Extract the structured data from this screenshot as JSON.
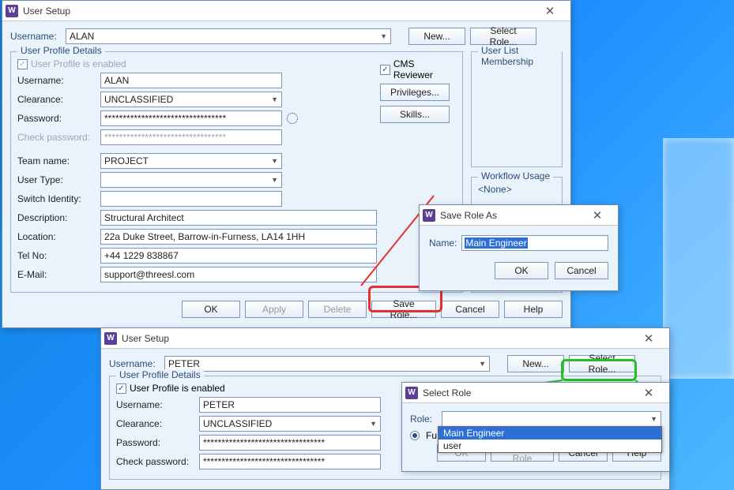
{
  "win1": {
    "title": "User Setup",
    "usernameLabel": "Username:",
    "usernameValue": "ALAN",
    "newBtn": "New...",
    "selectRoleBtn": "Select Role...",
    "profileGroup": "User Profile Details",
    "profileEnabled": "User Profile is enabled",
    "cmsReviewer": "CMS Reviewer",
    "privilegesBtn": "Privileges...",
    "skillsBtn": "Skills...",
    "fields": {
      "username": {
        "label": "Username:",
        "value": "ALAN"
      },
      "clearance": {
        "label": "Clearance:",
        "value": "UNCLASSIFIED"
      },
      "password": {
        "label": "Password:",
        "value": "*********************************"
      },
      "checkpwd": {
        "label": "Check password:",
        "value": "*********************************"
      },
      "teamname": {
        "label": "Team name:",
        "value": "PROJECT"
      },
      "usertype": {
        "label": "User Type:",
        "value": ""
      },
      "switchid": {
        "label": "Switch Identity:",
        "value": ""
      },
      "description": {
        "label": "Description:",
        "value": "Structural Architect"
      },
      "location": {
        "label": "Location:",
        "value": "22a Duke Street, Barrow-in-Furness, LA14 1HH"
      },
      "telno": {
        "label": "Tel No:",
        "value": "+44 1229 838867"
      },
      "email": {
        "label": "E-Mail:",
        "value": "support@threesl.com"
      }
    },
    "userListGroup": "User List Membership",
    "userListNone": "<None>",
    "workflowGroup": "Workflow Usage",
    "workflowNone": "<None>",
    "bottom": {
      "ok": "OK",
      "apply": "Apply",
      "delete": "Delete",
      "saveRole": "Save Role...",
      "cancel": "Cancel",
      "help": "Help"
    }
  },
  "saveRoleDlg": {
    "title": "Save Role As",
    "nameLabel": "Name:",
    "nameValue": "Main Engineer",
    "ok": "OK",
    "cancel": "Cancel"
  },
  "win2": {
    "title": "User Setup",
    "usernameLabel": "Username:",
    "usernameValue": "PETER",
    "newBtn": "New...",
    "selectRoleBtn": "Select Role...",
    "profileGroup": "User Profile Details",
    "profileEnabled": "User Profile is enabled",
    "fields": {
      "username": {
        "label": "Username:",
        "value": "PETER"
      },
      "clearance": {
        "label": "Clearance:",
        "value": "UNCLASSIFIED"
      },
      "password": {
        "label": "Password:",
        "value": "*********************************"
      },
      "checkpwd": {
        "label": "Check password:",
        "value": "*********************************"
      }
    }
  },
  "selectRoleDlg": {
    "title": "Select Role",
    "roleLabel": "Role:",
    "fullLabel": "Fu",
    "options": [
      "Main Engineer",
      "user"
    ],
    "ok": "OK",
    "deleteRole": "Delete Role",
    "cancel": "Cancel",
    "help": "Help"
  }
}
